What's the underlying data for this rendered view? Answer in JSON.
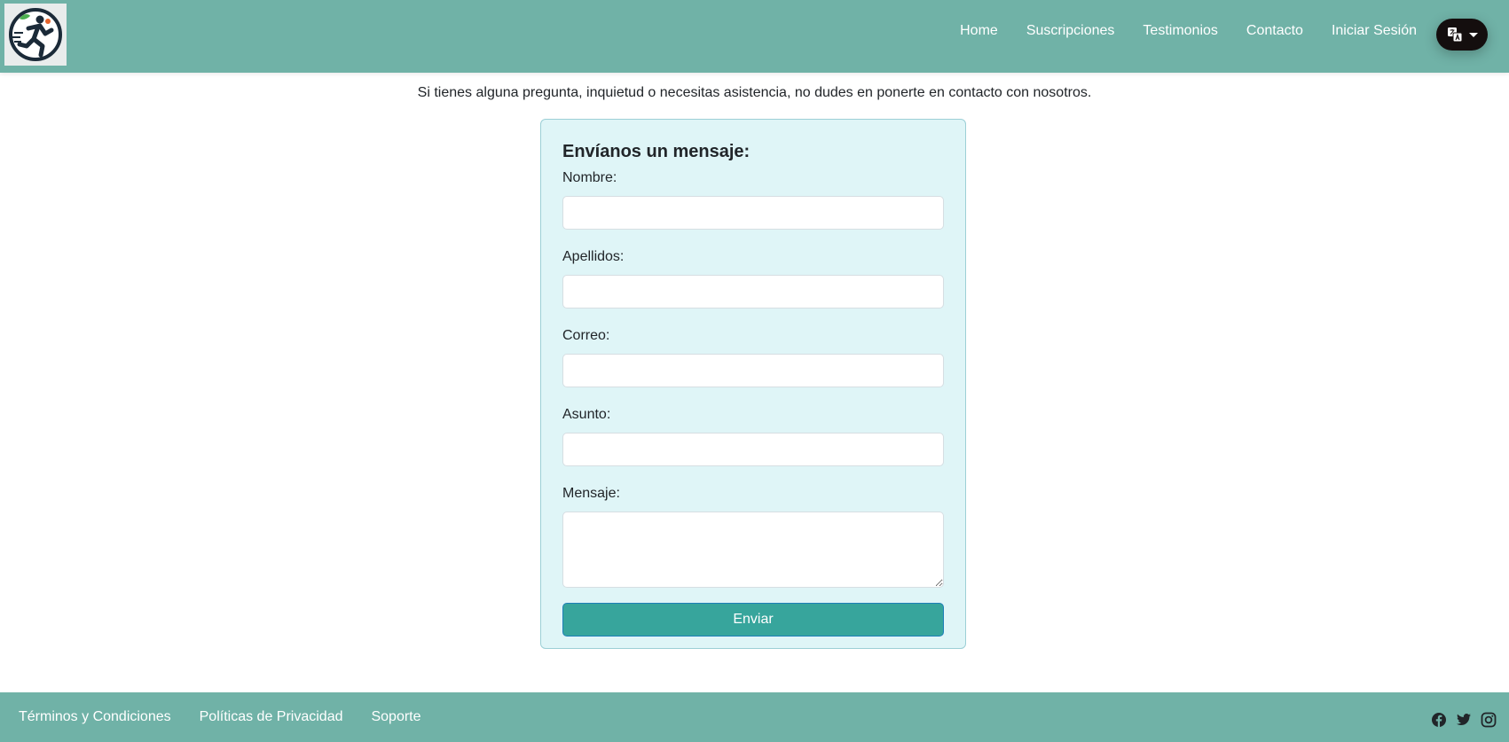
{
  "nav": {
    "links": [
      "Home",
      "Suscripciones",
      "Testimonios",
      "Contacto",
      "Iniciar Sesión"
    ],
    "language_icon": "translate-icon"
  },
  "hero": {
    "subtitle": "Si tienes alguna pregunta, inquietud o necesitas asistencia, no dudes en ponerte en contacto con nosotros."
  },
  "form": {
    "title": "Envíanos un mensaje:",
    "fields": {
      "nombre": {
        "label": "Nombre:",
        "value": ""
      },
      "apellidos": {
        "label": "Apellidos:",
        "value": ""
      },
      "correo": {
        "label": "Correo:",
        "value": ""
      },
      "asunto": {
        "label": "Asunto:",
        "value": ""
      },
      "mensaje": {
        "label": "Mensaje:",
        "value": ""
      }
    },
    "submit_label": "Enviar"
  },
  "footer": {
    "links": [
      "Términos y Condiciones",
      "Políticas de Privacidad",
      "Soporte"
    ],
    "social_icons": [
      "facebook-icon",
      "twitter-icon",
      "instagram-icon"
    ]
  },
  "colors": {
    "nav_bg": "#70b2a7",
    "card_bg": "#dff5f7",
    "button_bg": "#37a59c",
    "lang_button_bg": "#140e0e"
  }
}
